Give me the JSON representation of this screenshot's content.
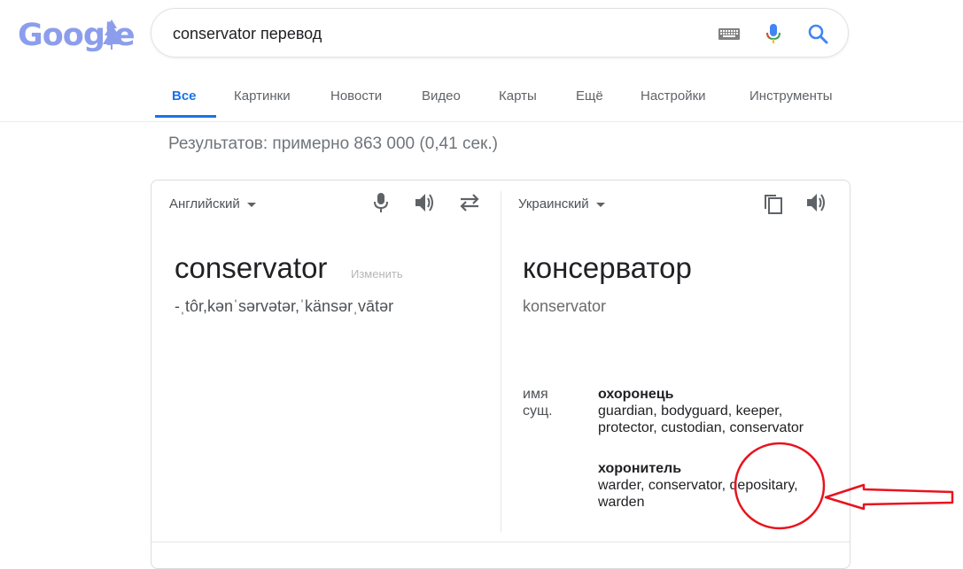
{
  "logo": {
    "text": "Google"
  },
  "search": {
    "query": "conservator перевод"
  },
  "icons": {
    "keyboard": "keyboard-icon",
    "mic": "microphone-icon",
    "search": "search-icon"
  },
  "colors": {
    "accent": "#1a73e8",
    "logo": "#8c9eeb",
    "annotation": "#e8131e"
  },
  "tabs": [
    {
      "label": "Все",
      "active": true
    },
    {
      "label": "Картинки"
    },
    {
      "label": "Новости"
    },
    {
      "label": "Видео"
    },
    {
      "label": "Карты"
    },
    {
      "label": "Ещё"
    },
    {
      "label": "Настройки"
    },
    {
      "label": "Инструменты"
    }
  ],
  "result_stats": "Результатов: примерно 863 000 (0,41 сек.)",
  "translate": {
    "source_lang": "Английский",
    "target_lang": "Украинский",
    "source_word": "conservator",
    "edit_label": "Изменить",
    "phonetic": "-ˌtôr,kənˈsərvətər,ˈkänsərˌvātər",
    "target_word": "консерватор",
    "transliteration": "konservator",
    "part_of_speech": "имя сущ.",
    "entries": [
      {
        "word": "охоронець",
        "synonyms": "guardian, bodyguard, keeper, protector, custodian, conservator"
      },
      {
        "word": "хоронитель",
        "synonyms": "warder, conservator, depositary, warden"
      }
    ]
  }
}
